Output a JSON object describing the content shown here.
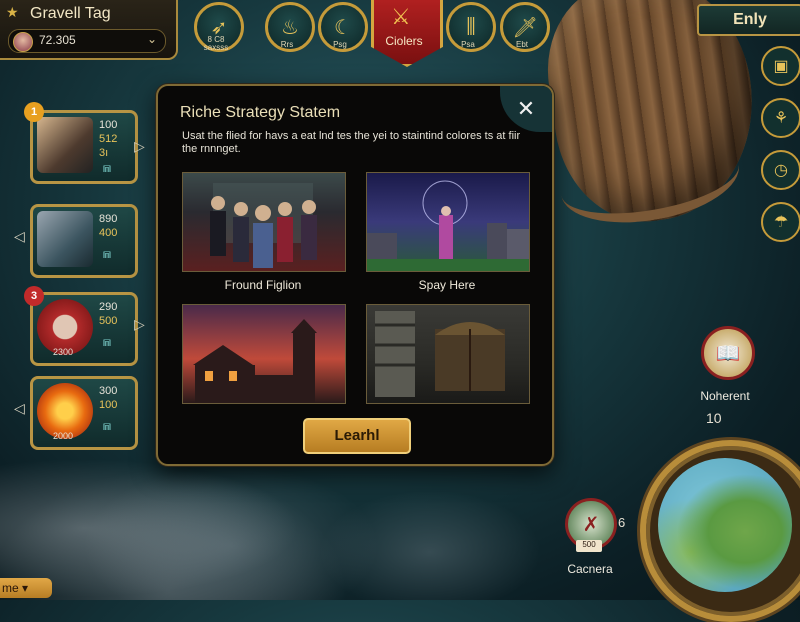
{
  "player": {
    "name": "Gravell Tag",
    "score": "72.305"
  },
  "top_bar": {
    "icons": [
      {
        "label": "8 C8\nsaxsss",
        "icon": "wing-icon"
      },
      {
        "label": "Rrs",
        "icon": "flame-icon"
      },
      {
        "label": "Psg",
        "icon": "moon-icon"
      },
      {
        "label": "Psa",
        "icon": "pillars-icon"
      },
      {
        "label": "Ebt",
        "icon": "sword-icon"
      }
    ],
    "center_badge": "Ciolers",
    "right_button": "Enly"
  },
  "cards": [
    {
      "v1": "100",
      "v2": "512",
      "v3": "3ı",
      "badge": "1",
      "badge_color": "#e8a020"
    },
    {
      "v1": "890",
      "v2": "400"
    },
    {
      "v1": "290",
      "v2": "500",
      "bottom": "2300",
      "badge": "3",
      "badge_color": "#c22a2a"
    },
    {
      "v1": "300",
      "v2": "100",
      "bottom": "2000"
    }
  ],
  "modal": {
    "title": "Riche Strategy Statem",
    "description": "Usat the flied for havs a eat lnd tes the yei to staintind colores ts at fiir the rnnnget.",
    "tiles": [
      {
        "caption": "Fround Figlion"
      },
      {
        "caption": "Spay Here"
      },
      {
        "caption": ""
      },
      {
        "caption": ""
      }
    ],
    "button": "Learhl"
  },
  "right_panel": {
    "coin_label": "Noherent",
    "map_count": "10",
    "cache_label": "Cacnera",
    "cache_value": "500",
    "cache_count": "6"
  },
  "home_tab": "me"
}
